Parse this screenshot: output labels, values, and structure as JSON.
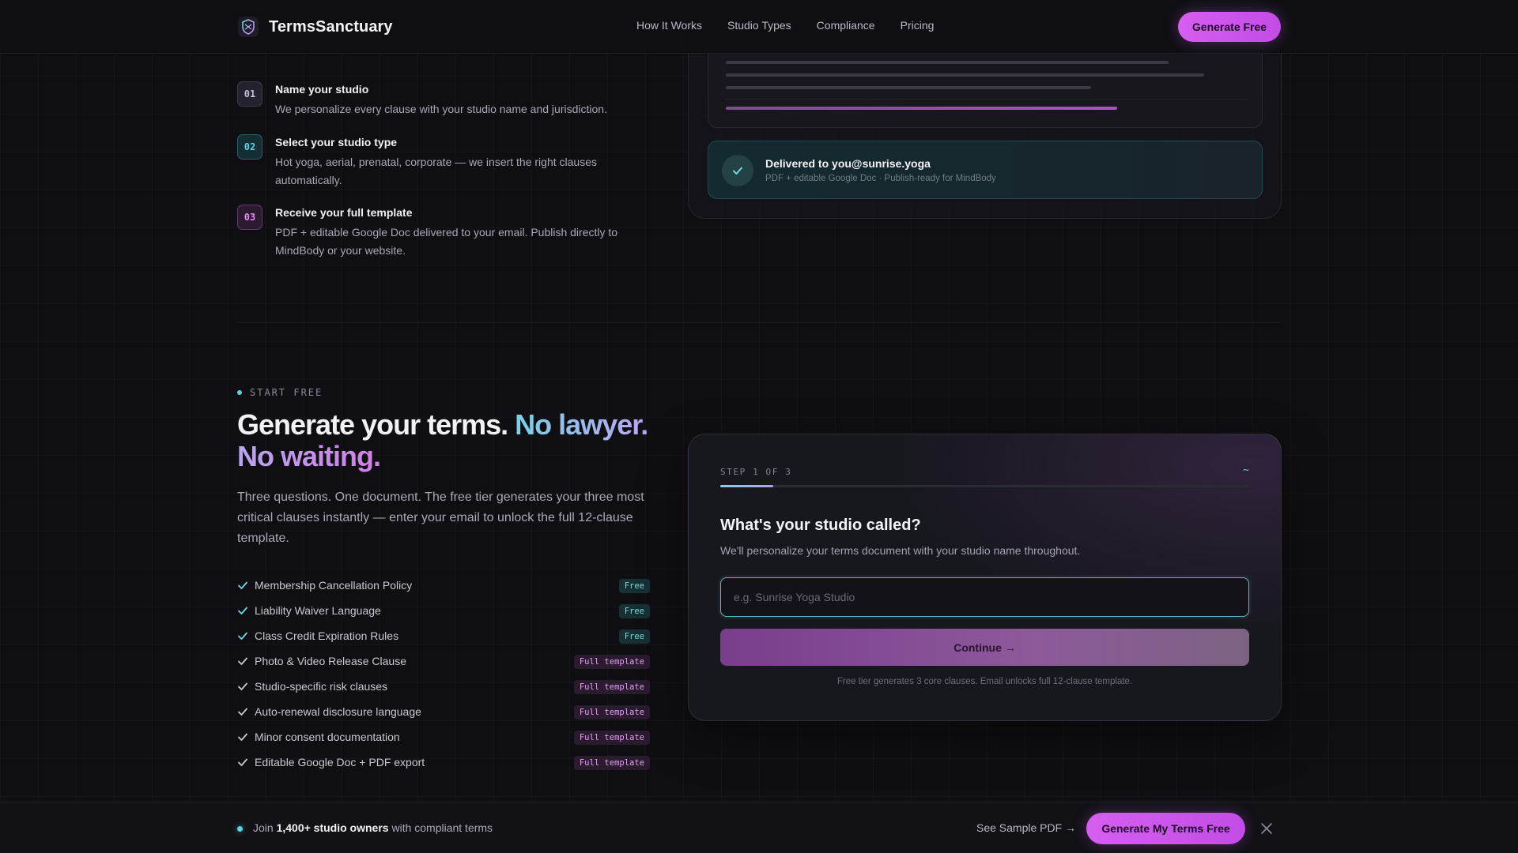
{
  "nav": {
    "brand": "TermsSanctuary",
    "links": [
      "How It Works",
      "Studio Types",
      "Compliance",
      "Pricing"
    ],
    "cta": "Generate Free"
  },
  "steps": [
    {
      "num": "01",
      "title": "Name your studio",
      "desc": "We personalize every clause with your studio name and jurisdiction."
    },
    {
      "num": "02",
      "title": "Select your studio type",
      "desc": "Hot yoga, aerial, prenatal, corporate — we insert the right clauses automatically."
    },
    {
      "num": "03",
      "title": "Receive your full template",
      "desc": "PDF + editable Google Doc delivered to your email. Publish directly to MindBody or your website."
    }
  ],
  "delivery": {
    "title": "Delivered to you@sunrise.yoga",
    "subtitle": "PDF + editable Google Doc · Publish-ready for MindBody"
  },
  "start": {
    "eyebrow": "START FREE",
    "headline_plain": "Generate your terms.",
    "headline_accent": "No lawyer. No waiting.",
    "lead": "Three questions. One document. The free tier generates your three most critical clauses instantly — enter your email to unlock the full 12-clause template.",
    "features": [
      {
        "label": "Membership Cancellation Policy",
        "tag": "Free"
      },
      {
        "label": "Liability Waiver Language",
        "tag": "Free"
      },
      {
        "label": "Class Credit Expiration Rules",
        "tag": "Free"
      },
      {
        "label": "Photo & Video Release Clause",
        "tag": "Full template"
      },
      {
        "label": "Studio-specific risk clauses",
        "tag": "Full template"
      },
      {
        "label": "Auto-renewal disclosure language",
        "tag": "Full template"
      },
      {
        "label": "Minor consent documentation",
        "tag": "Full template"
      },
      {
        "label": "Editable Google Doc + PDF export",
        "tag": "Full template"
      }
    ]
  },
  "form": {
    "step_label": "STEP 1 OF 3",
    "step_mark": "~",
    "progress": 0.1,
    "question": "What's your studio called?",
    "subtext": "We'll personalize your terms document with your studio name throughout.",
    "input_value": "",
    "input_placeholder": "e.g. Sunrise Yoga Studio",
    "continue_label": "Continue →",
    "note": "Free tier generates 3 core clauses. Email unlocks full 12-clause template."
  },
  "sticky": {
    "prefix": "Join ",
    "highlight": "1,400+ studio owners",
    "suffix": " with compliant terms",
    "sample_link": "See Sample PDF →",
    "cta": "Generate My Terms Free"
  },
  "colors": {
    "accent_pink": "#d65ef0",
    "accent_cyan": "#5fd3dd",
    "background": "#0f0f13"
  },
  "icons": {
    "brand": "shield-logo-icon",
    "check": "check-icon",
    "close": "close-icon"
  }
}
